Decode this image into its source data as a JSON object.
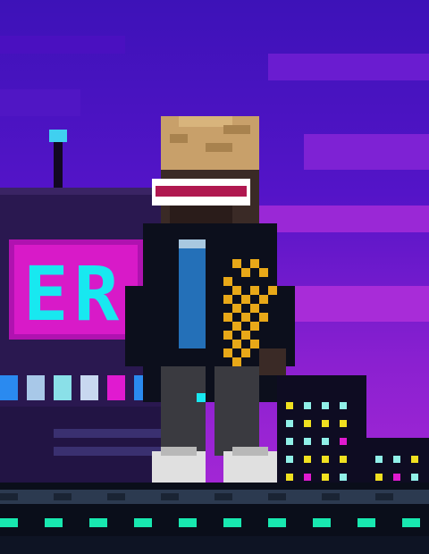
{
  "scene": {
    "sign_text": "ER",
    "colors": {
      "sky_top": "#3b10b8",
      "sky_mid": "#5a18d0",
      "sky_glow": "#b02ad8",
      "neon_pink": "#e01ad0",
      "neon_cyan": "#18e8f0",
      "visor_band": "#b01850",
      "hair": "#c8a06a",
      "jacket": "#0c0f1c",
      "shirt": "#2470b8",
      "pants": "#3a3a40",
      "shoes": "#e0e0e0",
      "checker_gold": "#e8a818",
      "road_dash": "#18e8b0"
    },
    "icons": [
      "antenna-light",
      "building-window"
    ]
  }
}
